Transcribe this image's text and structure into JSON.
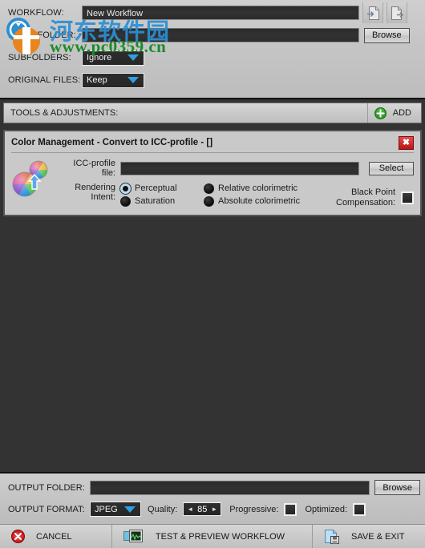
{
  "header": {
    "workflow_label": "WORKFLOW:",
    "workflow_value": "New Workflow",
    "input_folder_label": "INPUT FOLDER:",
    "input_folder_value": "",
    "subfolders_label": "SUBFOLDERS:",
    "subfolders_value": "Ignore",
    "original_files_label": "ORIGINAL FILES:",
    "original_files_value": "Keep",
    "browse_label": "Browse",
    "load_icon": "document-load-icon",
    "save_icon": "document-save-icon"
  },
  "watermark": {
    "cn_text": "河东软件园",
    "url_text": "www.pc0359.cn",
    "cn_color": "#2b8fd4",
    "url_color": "#1d8a2a"
  },
  "tools": {
    "title": "TOOLS & ADJUSTMENTS:",
    "add_label": "ADD",
    "add_icon": "plus-circle-icon",
    "add_color": "#2f9b28"
  },
  "color_panel": {
    "title": "Color Management - Convert to ICC-profile  - []",
    "close_icon": "close-icon",
    "close_color": "#c41616",
    "panel_icon": "color-wheel-convert-icon",
    "icc_label": "ICC-profile file:",
    "icc_label_line1": "ICC-profile",
    "icc_label_line2": "file:",
    "icc_value": "",
    "select_label": "Select",
    "rendering_label_line1": "Rendering",
    "rendering_label_line2": "Intent:",
    "intents": [
      {
        "label": "Perceptual",
        "selected": true
      },
      {
        "label": "Relative colorimetric",
        "selected": false
      },
      {
        "label": "Saturation",
        "selected": false
      },
      {
        "label": "Absolute colorimetric",
        "selected": false
      }
    ],
    "bpc_label_line1": "Black Point",
    "bpc_label_line2": "Compensation:",
    "bpc_checked": false
  },
  "output": {
    "folder_label": "OUTPUT FOLDER:",
    "folder_value": "",
    "browse_label": "Browse",
    "format_label": "OUTPUT FORMAT:",
    "format_value": "JPEG",
    "quality_label": "Quality:",
    "quality_value": "85",
    "quality_dec": "◄",
    "quality_inc": "►",
    "progressive_label": "Progressive:",
    "progressive_checked": false,
    "optimized_label": "Optimized:",
    "optimized_checked": false
  },
  "bottom": {
    "cancel_label": "CANCEL",
    "cancel_icon": "cancel-circle-icon",
    "test_label": "TEST & PREVIEW WORKFLOW",
    "test_icon": "preview-monitor-icon",
    "save_label": "SAVE & EXIT",
    "save_icon": "save-disk-icon"
  },
  "theme": {
    "dark_bg": "#333333",
    "panel_bg": "#c9c9c9",
    "accent_blue": "#2f9fe0"
  }
}
